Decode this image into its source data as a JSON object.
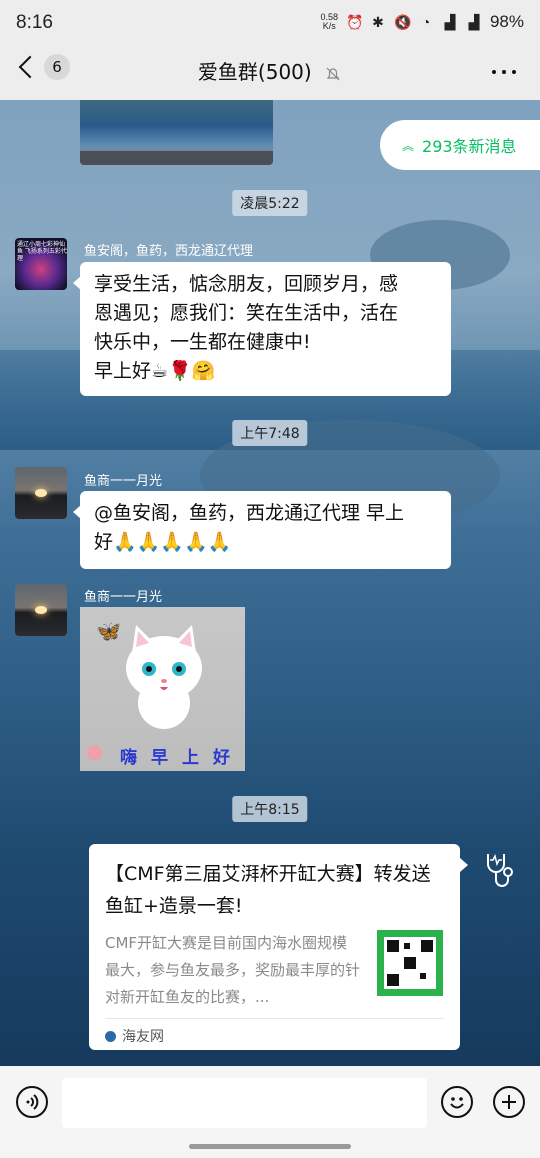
{
  "status_bar": {
    "time": "8:16",
    "speed_value": "0.58",
    "speed_unit": "K/s",
    "battery": "98%",
    "icons": [
      "alarm-icon",
      "bluetooth-icon",
      "mute-icon",
      "wifi-icon",
      "signal-4g-icon",
      "signal-4g-icon"
    ]
  },
  "nav": {
    "unread_count": "6",
    "title": "爱鱼群(500)",
    "mute_icon": "bell-off-icon"
  },
  "new_messages": "293条新消息",
  "messages": [
    {
      "time": "凌晨5:22"
    },
    {
      "sender": "鱼安阁，鱼药，西龙通辽代理",
      "text_line1": "享受生活，惦念朋友，回顾岁月，感",
      "text_line2": "恩遇见；愿我们：笑在生活中，活在",
      "text_line3": "快乐中，一生都在健康中!",
      "text_line4": "早上好☕🌹🤗"
    },
    {
      "time": "上午7:48"
    },
    {
      "sender": "鱼商一一月光",
      "text_line1": "@鱼安阁，鱼药，西龙通辽代理  早上",
      "text_line2": "好🙏🙏🙏🙏🙏"
    },
    {
      "sender": "鱼商一一月光",
      "sticker_text": "嗨早上好"
    },
    {
      "time": "上午8:15"
    }
  ],
  "avatar_text": "通辽小周七彩神仙鱼 飞扬系列五彩代理",
  "card": {
    "title": "【CMF第三届艾湃杯开缸大赛】转发送鱼缸+造景一套!",
    "description": "CMF开缸大赛是目前国内海水圈规模最大，参与鱼友最多，奖励最丰厚的针对新开缸鱼友的比赛，...",
    "source": "海友网"
  },
  "colors": {
    "accent": "#07c160",
    "bar_bg": "#ededed",
    "sticker_text": "#2a3ad0"
  }
}
